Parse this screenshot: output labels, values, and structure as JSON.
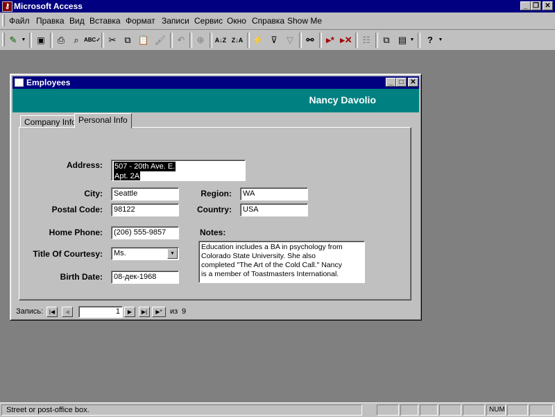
{
  "app": {
    "title": "Microsoft Access"
  },
  "menu": {
    "items": [
      "Файл",
      "Правка",
      "Вид",
      "Вставка",
      "Формат",
      "Записи",
      "Сервис",
      "Окно",
      "Справка",
      "Show Me"
    ]
  },
  "toolbar": {
    "icons": [
      "design-view-icon",
      "save-icon",
      "print-icon",
      "print-preview-icon",
      "spelling-icon",
      "cut-icon",
      "copy-icon",
      "paste-icon",
      "format-painter-icon",
      "undo-icon",
      "insert-hyperlink-icon",
      "sort-ascending-icon",
      "sort-descending-icon",
      "filter-by-selection-icon",
      "filter-by-form-icon",
      "apply-filter-icon",
      "find-icon",
      "new-record-icon",
      "delete-record-icon",
      "properties-icon",
      "database-window-icon",
      "new-object-icon",
      "help-icon"
    ]
  },
  "form": {
    "title": "Employees",
    "header_name": "Nancy Davolio",
    "tabs": [
      "Company Info",
      "Personal Info"
    ],
    "active_tab": "Personal Info",
    "labels": {
      "address": "Address:",
      "city": "City:",
      "region": "Region:",
      "postal_code": "Postal Code:",
      "country": "Country:",
      "home_phone": "Home Phone:",
      "notes": "Notes:",
      "title_of_courtesy": "Title Of Courtesy:",
      "birth_date": "Birth Date:"
    },
    "values": {
      "address_line1": "507 - 20th Ave. E.",
      "address_line2": "Apt. 2A",
      "city": "Seattle",
      "region": "WA",
      "postal_code": "98122",
      "country": "USA",
      "home_phone": "(206) 555-9857",
      "title_of_courtesy": "Ms.",
      "birth_date": "08-дек-1968",
      "notes_lines": [
        "Education includes a BA in psychology from",
        "Colorado State University.  She also",
        "completed \"The Art of the Cold Call.\"  Nancy",
        "is a member of Toastmasters International."
      ]
    },
    "navigator": {
      "label": "Запись:",
      "current": "1",
      "of_label": "из",
      "total": "9"
    }
  },
  "statusbar": {
    "message": "Street or post-office box.",
    "num": "NUM"
  }
}
